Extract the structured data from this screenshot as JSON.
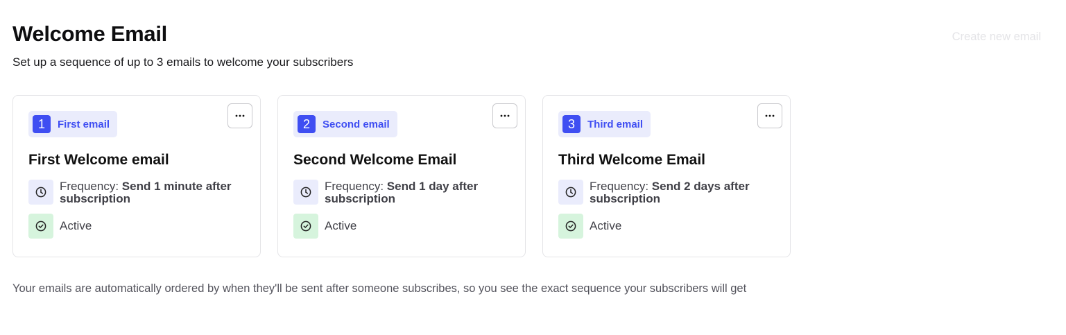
{
  "header": {
    "title": "Welcome Email",
    "subtitle": "Set up a sequence of up to 3 emails to welcome your subscribers",
    "create_label": "Create new email"
  },
  "cards": [
    {
      "number": "1",
      "badge": "First email",
      "title": "First Welcome email",
      "frequency_label": "Frequency:",
      "frequency_value": "Send 1 minute after subscription",
      "status": "Active",
      "more_label": "···"
    },
    {
      "number": "2",
      "badge": "Second email",
      "title": "Second Welcome Email",
      "frequency_label": "Frequency:",
      "frequency_value": "Send 1 day after subscription",
      "status": "Active",
      "more_label": "···"
    },
    {
      "number": "3",
      "badge": "Third email",
      "title": "Third Welcome Email",
      "frequency_label": "Frequency:",
      "frequency_value": "Send 2 days after subscription",
      "status": "Active",
      "more_label": "···"
    }
  ],
  "footnote": "Your emails are automatically ordered by when they'll be sent after someone subscribes, so you see the exact sequence your subscribers will get",
  "icons": {
    "more": "more-horizontal-icon",
    "frequency": "clock-icon",
    "status": "check-circle-icon"
  },
  "colors": {
    "accent": "#3f4ef2",
    "badge_bg": "#eaecfc",
    "active_bg": "#d6f4dd",
    "create_btn_text": "#e4e4e7"
  }
}
